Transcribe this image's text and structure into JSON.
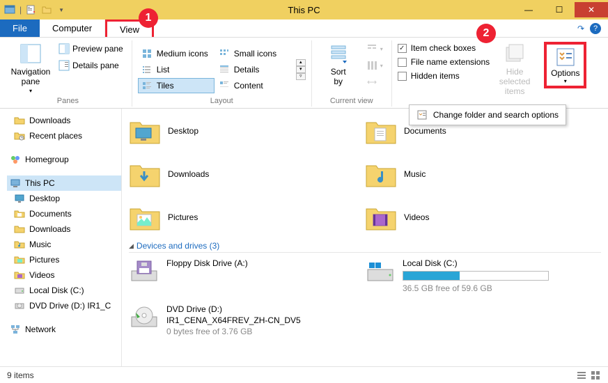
{
  "window": {
    "title": "This PC"
  },
  "callouts": {
    "one": "1",
    "two": "2"
  },
  "tabs": {
    "file": "File",
    "computer": "Computer",
    "view": "View"
  },
  "ribbon": {
    "panes": {
      "nav": "Navigation\npane",
      "preview": "Preview pane",
      "details": "Details pane",
      "label": "Panes"
    },
    "layout": {
      "medium": "Medium icons",
      "small": "Small icons",
      "list": "List",
      "details": "Details",
      "tiles": "Tiles",
      "content": "Content",
      "label": "Layout"
    },
    "current": {
      "sortby": "Sort\nby",
      "label": "Current view"
    },
    "showhide": {
      "checkboxes": "Item check boxes",
      "extensions": "File name extensions",
      "hidden": "Hidden items",
      "hidebtn": "Hide selected\nitems"
    },
    "options": {
      "label": "Options",
      "menu": "Change folder and search options"
    }
  },
  "sidebar": {
    "downloads": "Downloads",
    "recent": "Recent places",
    "homegroup": "Homegroup",
    "thispc": "This PC",
    "desktop": "Desktop",
    "documents": "Documents",
    "sdownloads": "Downloads",
    "music": "Music",
    "pictures": "Pictures",
    "videos": "Videos",
    "localdisk": "Local Disk (C:)",
    "dvd": "DVD Drive (D:) IR1_C",
    "network": "Network"
  },
  "folders": {
    "desktop": "Desktop",
    "documents": "Documents",
    "downloads": "Downloads",
    "music": "Music",
    "pictures": "Pictures",
    "videos": "Videos"
  },
  "section": {
    "devices": "Devices and drives (3)"
  },
  "drives": {
    "floppy": {
      "name": "Floppy Disk Drive (A:)"
    },
    "local": {
      "name": "Local Disk (C:)",
      "sub": "36.5 GB free of 59.6 GB",
      "fill_pct": 39
    },
    "dvd": {
      "name": "DVD Drive (D:)",
      "label": "IR1_CENA_X64FREV_ZH-CN_DV5",
      "sub": "0 bytes free of 3.76 GB"
    }
  },
  "status": {
    "count": "9 items"
  }
}
